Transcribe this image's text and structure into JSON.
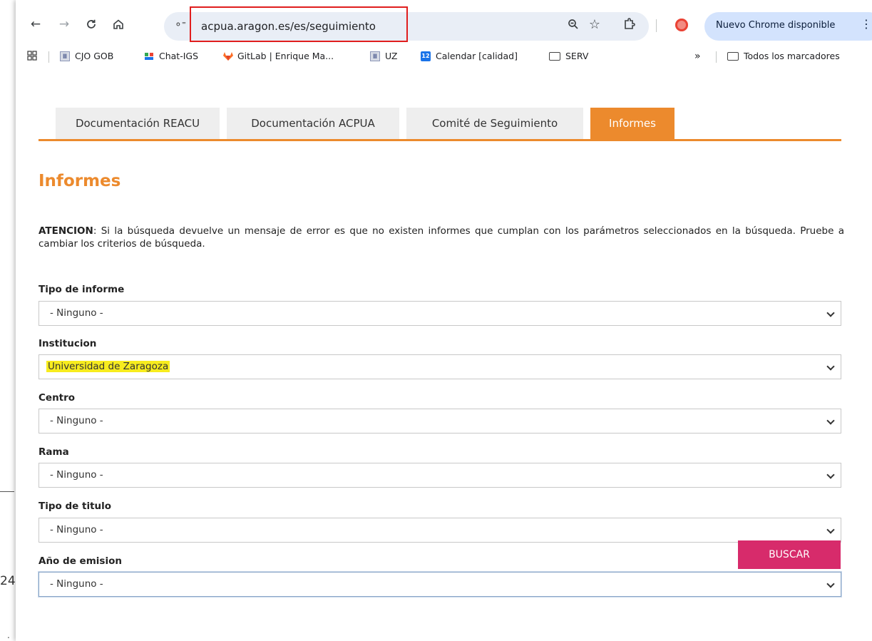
{
  "background_fragment": {
    "number": "24",
    "dot": "."
  },
  "browser": {
    "url": "acpua.aragon.es/es/seguimiento",
    "update_label": "Nuevo Chrome disponible",
    "bookmarks": [
      {
        "label": "CJO GOB",
        "icon": "government-icon"
      },
      {
        "label": "Chat-IGS",
        "icon": "chat-icon"
      },
      {
        "label": "GitLab | Enrique Ma...",
        "icon": "gitlab-icon"
      },
      {
        "label": "UZ",
        "icon": "government-icon"
      },
      {
        "label": "Calendar [calidad]",
        "icon": "calendar-icon",
        "icon_text": "12"
      },
      {
        "label": "SERV",
        "icon": "folder-icon"
      }
    ],
    "overflow_label": "»",
    "all_bookmarks_label": "Todos los marcadores"
  },
  "tabs": [
    {
      "label": "Documentación REACU",
      "active": false
    },
    {
      "label": "Documentación ACPUA",
      "active": false
    },
    {
      "label": "Comité de Seguimiento",
      "active": false
    },
    {
      "label": "Informes",
      "active": true
    }
  ],
  "page": {
    "title": "Informes",
    "notice_bold": "ATENCION",
    "notice_text": ": Si la búsqueda devuelve un mensaje de error es que no existen informes que cumplan con los parámetros seleccionados en la búsqueda. Pruebe a cambiar los criterios de búsqueda."
  },
  "form": {
    "tipo_informe": {
      "label": "Tipo de informe",
      "value": "- Ninguno -"
    },
    "institucion": {
      "label": "Institucion",
      "value": "Universidad de Zaragoza"
    },
    "centro": {
      "label": "Centro",
      "value": "- Ninguno -"
    },
    "rama": {
      "label": "Rama",
      "value": "- Ninguno -"
    },
    "tipo_titulo": {
      "label": "Tipo de titulo",
      "value": "- Ninguno -"
    },
    "anio": {
      "label": "Año de emision",
      "value": "- Ninguno -"
    },
    "submit_label": "BUSCAR"
  },
  "colors": {
    "accent_orange": "#ec8a2d",
    "submit_pink": "#d72b6b",
    "highlight_yellow": "#f7ec1e",
    "url_outline_red": "#e01e1e"
  }
}
